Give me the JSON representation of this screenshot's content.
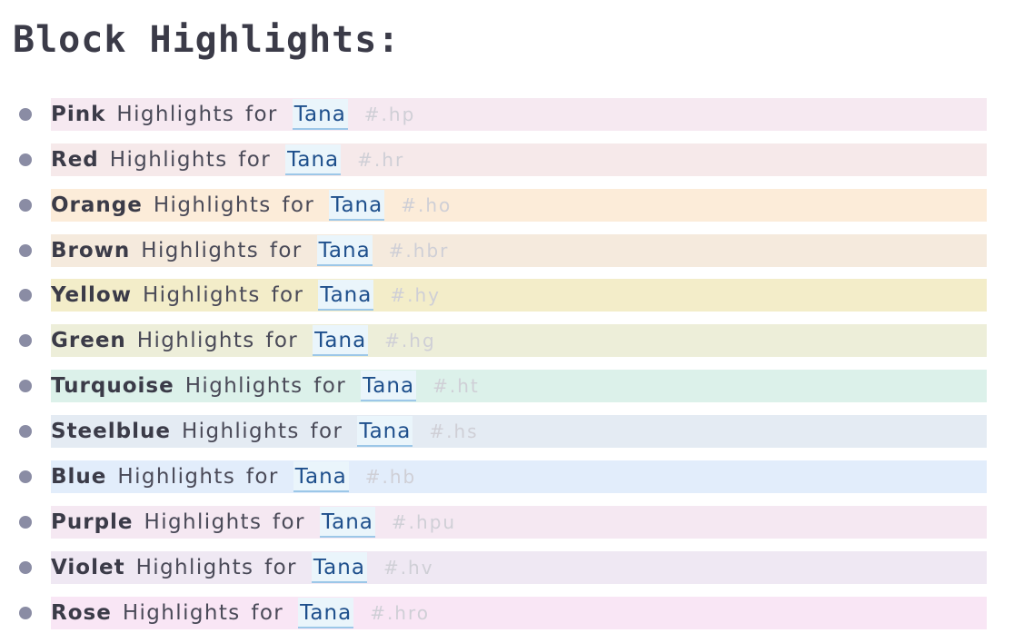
{
  "page": {
    "title": "Block Highlights:"
  },
  "highlights": [
    {
      "color": "Pink",
      "phrase": "Highlights for",
      "ref": "Tana",
      "tag": "#.hp",
      "bg": "#f6e9f1"
    },
    {
      "color": "Red",
      "phrase": "Highlights for",
      "ref": "Tana",
      "tag": "#.hr",
      "bg": "#f6e9ea"
    },
    {
      "color": "Orange",
      "phrase": "Highlights for",
      "ref": "Tana",
      "tag": "#.ho",
      "bg": "#fcecd9"
    },
    {
      "color": "Brown",
      "phrase": "Highlights for",
      "ref": "Tana",
      "tag": "#.hbr",
      "bg": "#f5eadd"
    },
    {
      "color": "Yellow",
      "phrase": "Highlights for",
      "ref": "Tana",
      "tag": "#.hy",
      "bg": "#f3edc9"
    },
    {
      "color": "Green",
      "phrase": "Highlights for",
      "ref": "Tana",
      "tag": "#.hg",
      "bg": "#edeed9"
    },
    {
      "color": "Turquoise",
      "phrase": "Highlights for",
      "ref": "Tana",
      "tag": "#.ht",
      "bg": "#dcf1ea"
    },
    {
      "color": "Steelblue",
      "phrase": "Highlights for",
      "ref": "Tana",
      "tag": "#.hs",
      "bg": "#e4ebf3"
    },
    {
      "color": "Blue",
      "phrase": "Highlights for",
      "ref": "Tana",
      "tag": "#.hb",
      "bg": "#e2edfb"
    },
    {
      "color": "Purple",
      "phrase": "Highlights for",
      "ref": "Tana",
      "tag": "#.hpu",
      "bg": "#f5e8f2"
    },
    {
      "color": "Violet",
      "phrase": "Highlights for",
      "ref": "Tana",
      "tag": "#.hv",
      "bg": "#efe8f3"
    },
    {
      "color": "Rose",
      "phrase": "Highlights for",
      "ref": "Tana",
      "tag": "#.hro",
      "bg": "#f9e6f5"
    }
  ]
}
